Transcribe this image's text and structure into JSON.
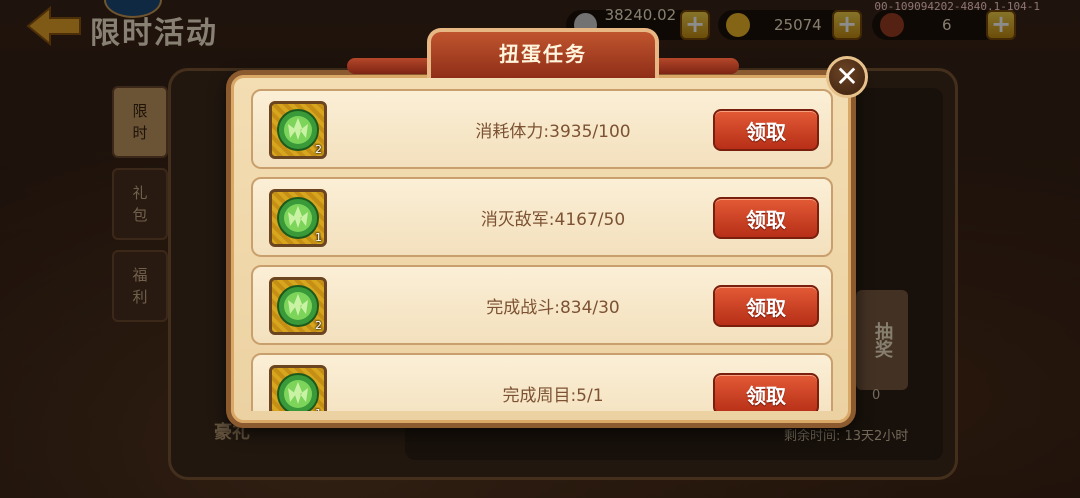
{
  "header": {
    "title": "限时活动",
    "resources": [
      {
        "name": "silver",
        "value": "38240.02万"
      },
      {
        "name": "gold",
        "value": "25074"
      },
      {
        "name": "meat",
        "value": "6"
      }
    ],
    "debug_id": "00-109094202-4840.1-104-1"
  },
  "side_tabs": [
    {
      "label": "限时",
      "active": true
    },
    {
      "label": "礼包",
      "active": false
    },
    {
      "label": "福利",
      "active": false
    }
  ],
  "background": {
    "draw_label": "抽奖",
    "draw_count": "0",
    "remaining_time": "剩余时间: 13天2小时",
    "bottom_label": "豪礼"
  },
  "modal": {
    "title": "扭蛋任务",
    "close_symbol": "✕",
    "tasks": [
      {
        "count": "2",
        "text": "消耗体力:3935/100",
        "button": "领取"
      },
      {
        "count": "1",
        "text": "消灭敌军:4167/50",
        "button": "领取"
      },
      {
        "count": "2",
        "text": "完成战斗:834/30",
        "button": "领取"
      },
      {
        "count": "1",
        "text": "完成周目:5/1",
        "button": "领取"
      }
    ]
  },
  "colors": {
    "accent_red": "#c8401f",
    "panel_tan": "#f3ddb2",
    "text_brown": "#7c5232"
  }
}
